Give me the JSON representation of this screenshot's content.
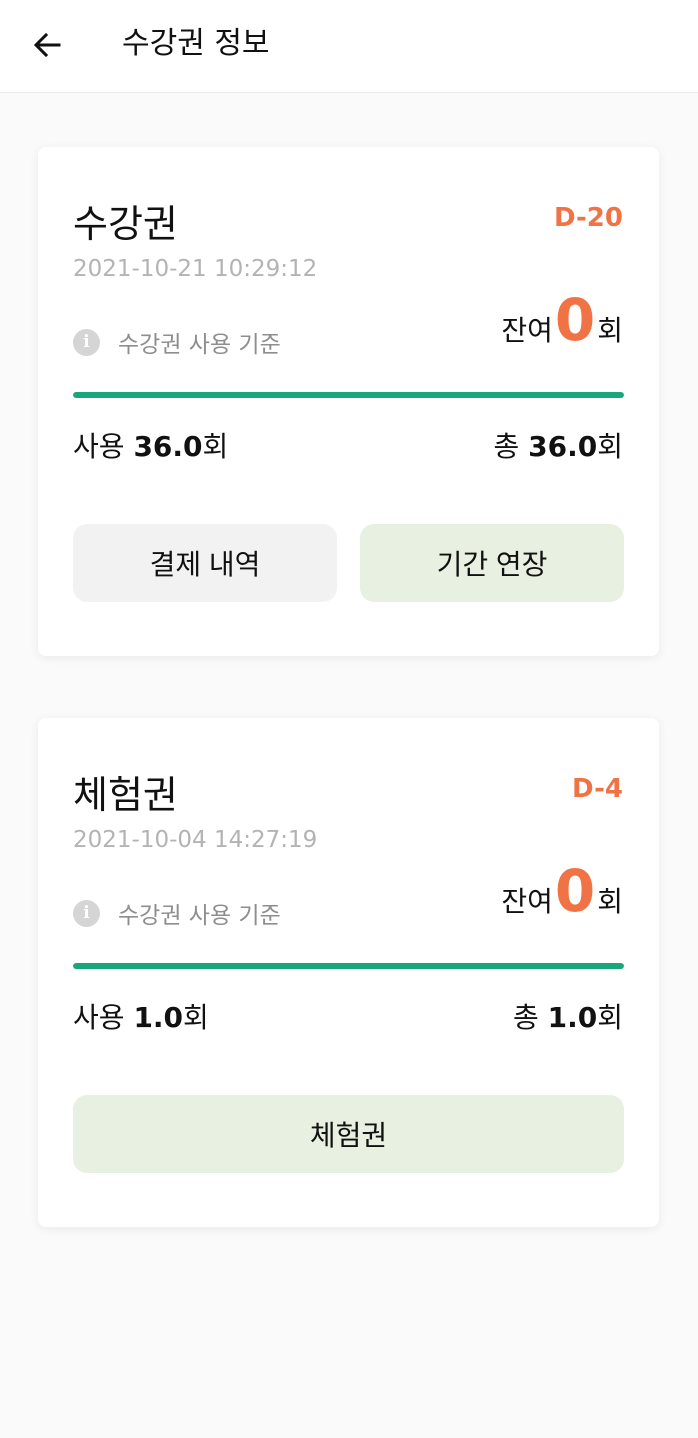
{
  "header": {
    "title": "수강권 정보",
    "back_icon": "arrow-left-icon"
  },
  "colors": {
    "accent_orange": "#ef7344",
    "progress_green": "#1aa67d",
    "button_grey": "#f2f2f2",
    "button_green": "#e8f0e1"
  },
  "tickets": [
    {
      "name": "수강권",
      "dday": "D-20",
      "date": "2021-10-21 10:29:12",
      "info_label": "수강권 사용 기준",
      "info_icon": "info-icon",
      "remaining_prefix": "잔여",
      "remaining_count": "0",
      "remaining_suffix": "회",
      "progress_used_fraction": 1.0,
      "usage_label": "사용",
      "usage_value": "36.0",
      "usage_unit": "회",
      "total_label": "총",
      "total_value": "36.0",
      "total_unit": "회",
      "buttons": [
        "결제 내역",
        "기간 연장"
      ]
    },
    {
      "name": "체험권",
      "dday": "D-4",
      "date": "2021-10-04 14:27:19",
      "info_label": "수강권 사용 기준",
      "info_icon": "info-icon",
      "remaining_prefix": "잔여",
      "remaining_count": "0",
      "remaining_suffix": "회",
      "progress_used_fraction": 1.0,
      "usage_label": "사용",
      "usage_value": "1.0",
      "usage_unit": "회",
      "total_label": "총",
      "total_value": "1.0",
      "total_unit": "회",
      "buttons": [
        "체험권"
      ]
    }
  ]
}
